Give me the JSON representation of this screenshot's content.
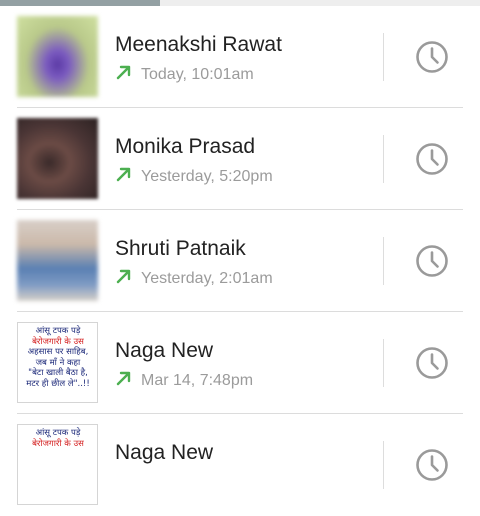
{
  "calls": [
    {
      "name": "Meenakshi Rawat",
      "time": "Today, 10:01am",
      "avatar_style": "blur1",
      "direction_icon": "outgoing-call-arrow-icon",
      "action_icon": "clock-icon"
    },
    {
      "name": "Monika Prasad",
      "time": "Yesterday, 5:20pm",
      "avatar_style": "blur2",
      "direction_icon": "outgoing-call-arrow-icon",
      "action_icon": "clock-icon"
    },
    {
      "name": "Shruti Patnaik",
      "time": "Yesterday, 2:01am",
      "avatar_style": "blur3",
      "direction_icon": "outgoing-call-arrow-icon",
      "action_icon": "clock-icon"
    },
    {
      "name": "Naga New",
      "time": "Mar 14, 7:48pm",
      "avatar_style": "quote",
      "avatar_lines": [
        "आंसू टपक पड़े",
        "बेरोजगारी के उस",
        "अहसास पर साहिब,",
        "जब माँ ने कहा",
        "\"बेटा खाली बैठा है,",
        "मटर ही छील ले\"..!!"
      ],
      "direction_icon": "outgoing-call-arrow-icon",
      "action_icon": "clock-icon"
    },
    {
      "name": "Naga New",
      "time": "",
      "avatar_style": "quote",
      "avatar_lines": [
        "आंसू टपक पड़े",
        "बेरोजगारी के उस"
      ],
      "direction_icon": "outgoing-call-arrow-icon",
      "action_icon": "clock-icon"
    }
  ],
  "colors": {
    "outgoing_arrow": "#4caf50",
    "clock": "#9a9a9a",
    "tab_indicator": "#93a0a3",
    "name_text": "#222222",
    "meta_text": "#9b9b9b"
  }
}
